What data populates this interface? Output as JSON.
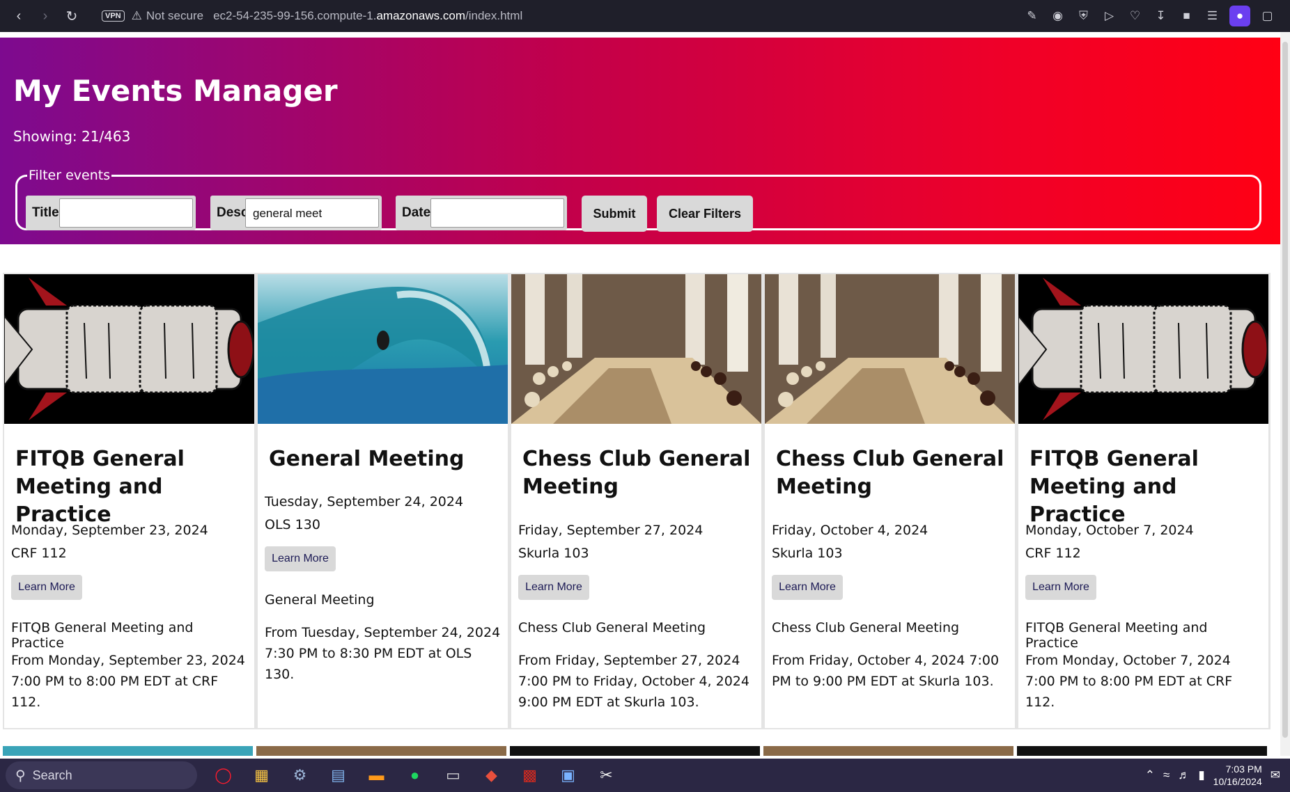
{
  "browser": {
    "vpn_label": "VPN",
    "not_secure": "Not secure",
    "url_prefix": "ec2-54-235-99-156.compute-1.",
    "url_domain": "amazonaws.com",
    "url_path": "/index.html"
  },
  "header": {
    "title": "My Events Manager",
    "showing": "Showing: 21/463",
    "filter_legend": "Filter events",
    "title_label": "Title",
    "title_value": "",
    "desc_label": "Desc",
    "desc_value": "general meet",
    "date_label": "Date",
    "date_value": "",
    "submit_label": "Submit",
    "clear_label": "Clear Filters"
  },
  "cards": [
    {
      "image": "rocket",
      "title": "FITQB General Meeting and Practice",
      "date": "Monday, September 23, 2024",
      "location": "CRF 112",
      "learn_more": "Learn More",
      "description": "FITQB General Meeting and Practice",
      "details": "From Monday, September 23, 2024 7:00 PM to 8:00 PM EDT at CRF 112."
    },
    {
      "image": "surf",
      "title": "General Meeting",
      "date": "Tuesday, September 24, 2024",
      "location": "OLS 130",
      "learn_more": "Learn More",
      "description": "General Meeting",
      "details": "From Tuesday, September 24, 2024 7:30 PM to 8:30 PM EDT at OLS 130."
    },
    {
      "image": "chess",
      "title": "Chess Club General Meeting",
      "date": "Friday, September 27, 2024",
      "location": "Skurla 103",
      "learn_more": "Learn More",
      "description": "Chess Club General Meeting",
      "details": "From Friday, September 27, 2024 7:00 PM to Friday, October 4, 2024 9:00 PM EDT at Skurla 103."
    },
    {
      "image": "chess",
      "title": "Chess Club General Meeting",
      "date": "Friday, October 4, 2024",
      "location": "Skurla 103",
      "learn_more": "Learn More",
      "description": "Chess Club General Meeting",
      "details": "From Friday, October 4, 2024 7:00 PM to 9:00 PM EDT at Skurla 103."
    },
    {
      "image": "rocket",
      "title": "FITQB General Meeting and Practice",
      "date": "Monday, October 7, 2024",
      "location": "CRF 112",
      "learn_more": "Learn More",
      "description": "FITQB General Meeting and Practice",
      "details": "From Monday, October 7, 2024 7:00 PM to 8:00 PM EDT at CRF 112."
    }
  ],
  "taskbar": {
    "search_label": "Search",
    "time": "7:03 PM",
    "date": "10/16/2024"
  },
  "colors": {
    "gradient_start": "#7d0a8f",
    "gradient_end": "#ff0014",
    "button_bg": "#d9d9d9",
    "learn_more_text": "#1c1a55"
  }
}
